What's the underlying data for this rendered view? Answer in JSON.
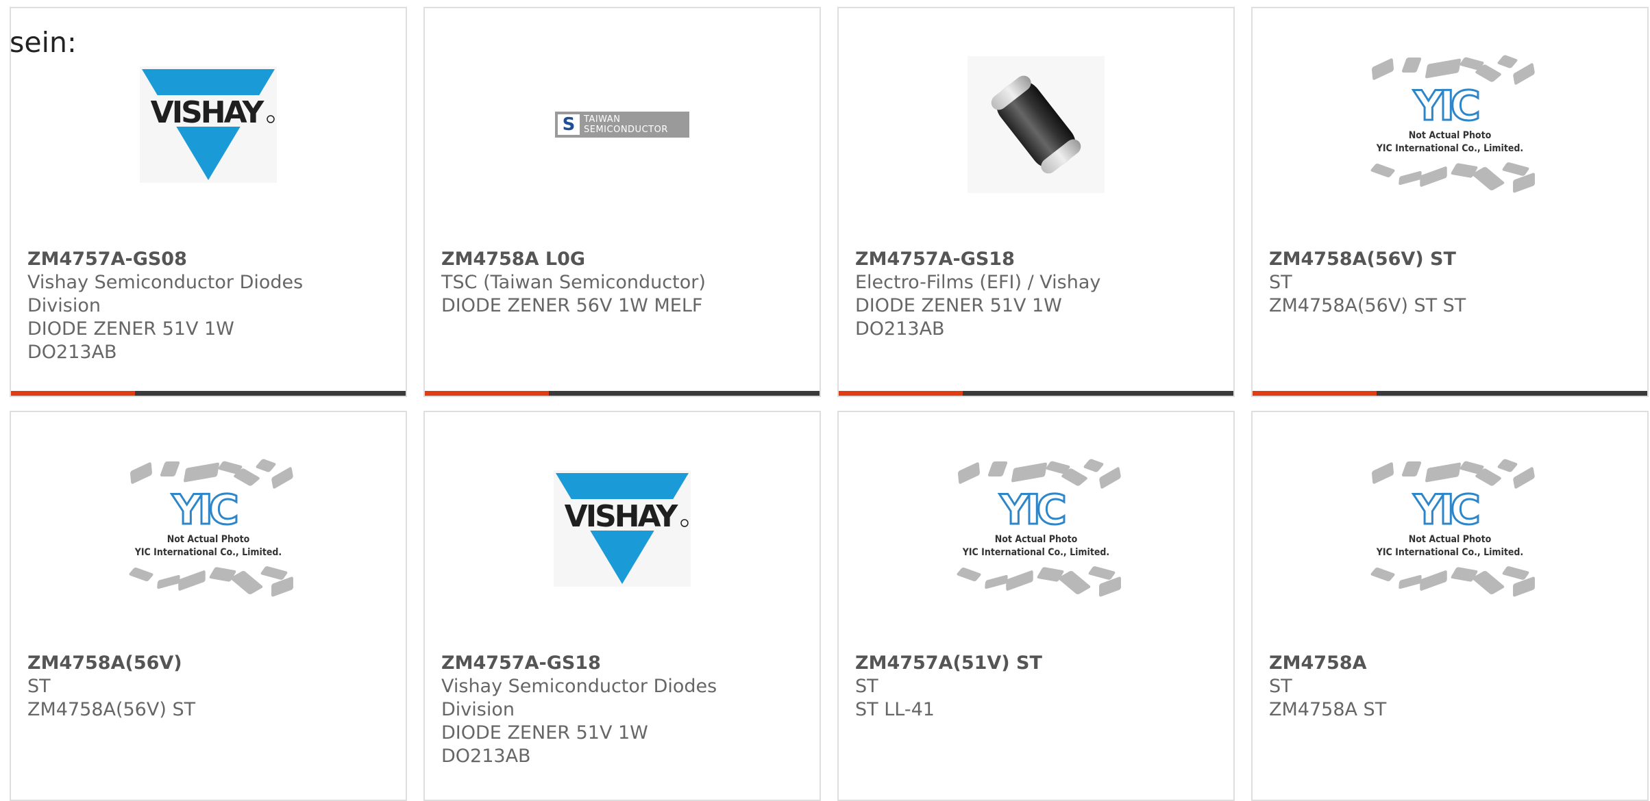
{
  "prefix_text": "sein:",
  "cards": [
    {
      "part_number": "ZM4757A-GS08",
      "manufacturer": "Vishay Semiconductor Diodes Division",
      "description": "DIODE ZENER 51V 1W DO213AB",
      "image": "vishay-logo"
    },
    {
      "part_number": "ZM4758A L0G",
      "manufacturer": "TSC (Taiwan Semiconductor)",
      "description": "DIODE ZENER 56V 1W MELF",
      "image": "taiwan-semiconductor-logo",
      "logo_text": [
        "TAIWAN",
        "SEMICONDUCTOR"
      ]
    },
    {
      "part_number": "ZM4757A-GS18",
      "manufacturer": "Electro-Films (EFI) / Vishay",
      "description": "DIODE ZENER 51V 1W DO213AB",
      "image": "melf-diode-photo"
    },
    {
      "part_number": "ZM4758A(56V) ST",
      "manufacturer": "ST",
      "description": "ZM4758A(56V) ST ST",
      "image": "yic-placeholder"
    },
    {
      "part_number": "ZM4758A(56V)",
      "manufacturer": "ST",
      "description": "ZM4758A(56V) ST",
      "image": "yic-placeholder"
    },
    {
      "part_number": "ZM4757A-GS18",
      "manufacturer": "Vishay Semiconductor Diodes Division",
      "description": "DIODE ZENER 51V 1W DO213AB",
      "image": "vishay-logo"
    },
    {
      "part_number": "ZM4757A(51V) ST",
      "manufacturer": "ST",
      "description": "ST LL-41",
      "image": "yic-placeholder"
    },
    {
      "part_number": "ZM4758A",
      "manufacturer": "ST",
      "description": "ZM4758A ST",
      "image": "yic-placeholder"
    }
  ],
  "yic": {
    "line1": "Not Actual Photo",
    "line2": "YIC International Co., Limited.",
    "mark": "YIC"
  },
  "vishay_text": "VISHAY",
  "colors": {
    "accent": "#e03e12",
    "bar": "#3a3a3a",
    "vishay_blue": "#1a9ad6",
    "border": "#dedede"
  }
}
